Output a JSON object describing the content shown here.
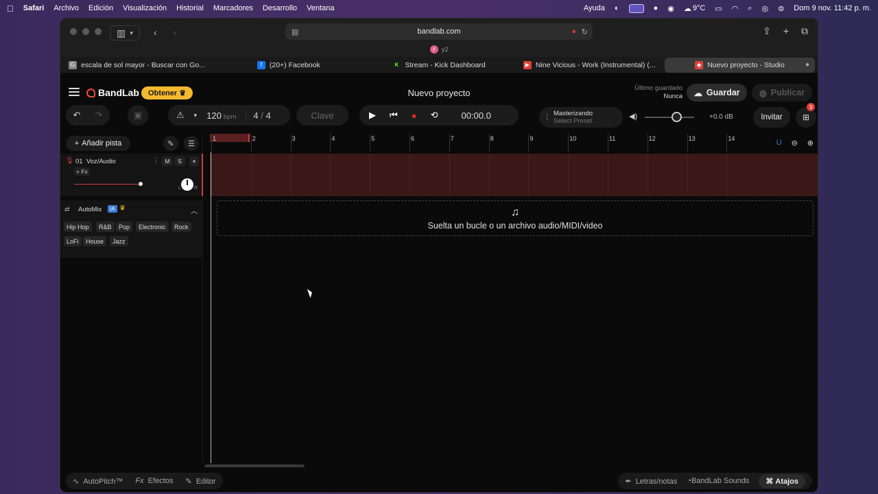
{
  "menubar": {
    "app": "Safari",
    "items": [
      "Archivo",
      "Edición",
      "Visualización",
      "Historial",
      "Marcadores",
      "Desarrollo",
      "Ventana"
    ],
    "right_help": "Ayuda",
    "temperature": "9°C",
    "datetime": "Dom 9 nov.  11:42 p. m."
  },
  "safari": {
    "url": "bandlab.com",
    "favorites_label": "y2",
    "tabs": [
      {
        "label": "escala de sol mayor - Buscar con Go...",
        "icon_color": "#888888",
        "icon": "G"
      },
      {
        "label": "(20+) Facebook",
        "icon_color": "#1877f2",
        "icon": "f"
      },
      {
        "label": "Stream - Kick Dashboard",
        "icon_color": "#53fc18",
        "icon": "K"
      },
      {
        "label": "Nine Vicious - Work (Instrumental) (...",
        "icon_color": "#e0403a",
        "icon": "▶"
      },
      {
        "label": "Nuevo proyecto - Studio",
        "icon_color": "#e0403a",
        "icon": "◆"
      }
    ]
  },
  "app": {
    "brand": "BandLab",
    "obtener": "Obtener",
    "project_title": "Nuevo proyecto",
    "last_saved_label": "Último guardado",
    "last_saved_value": "Nunca",
    "save": "Guardar",
    "publish": "Publicar"
  },
  "toolbar": {
    "bpm": "120",
    "bpm_unit": "bpm",
    "time_sig_num": "4",
    "time_sig_sep": "/",
    "time_sig_den": "4",
    "key": "Clave",
    "time": "00:00.0",
    "mastering_title": "Masterizando",
    "mastering_preset": "Select Preset",
    "volume_db": "+0.0 dB",
    "volume_level": 0.64,
    "invite": "Invitar",
    "notifications": "3"
  },
  "leftpanel": {
    "add_track": "Añadir pista",
    "track": {
      "number": "01",
      "name": "Voz/Audio",
      "fx": "+ Fx",
      "mute": "M",
      "solo": "S",
      "pan_left": "L",
      "pan_right": "R"
    },
    "automix": {
      "title": "AutoMix",
      "ia": "IA",
      "genres": [
        "Hip Hop",
        "R&B",
        "Pop",
        "Electronic",
        "Rock",
        "LoFi",
        "House",
        "Jazz"
      ]
    }
  },
  "timeline": {
    "bars": [
      "1",
      "2",
      "3",
      "4",
      "5",
      "6",
      "7",
      "8",
      "9",
      "10",
      "11",
      "12",
      "13",
      "14"
    ],
    "dropzone_text": "Suelta un bucle o un archivo audio/MIDI/video"
  },
  "bottombar": {
    "autopitch": "AutoPitch™",
    "effects": "Efectos",
    "editor": "Editor",
    "lyrics": "Letras/notas",
    "sounds_brand": "BandLab",
    "sounds": "Sounds",
    "shortcuts": "Atajos"
  }
}
